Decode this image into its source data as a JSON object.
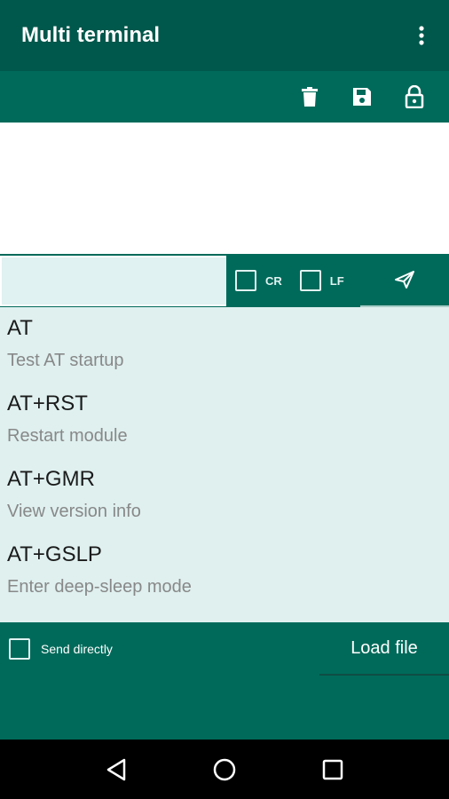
{
  "app": {
    "title": "Multi terminal"
  },
  "icons": {
    "overflow": "more-vert-icon",
    "clear": "trash-icon",
    "save": "save-icon",
    "lock": "lock-icon",
    "send": "send-icon",
    "nav_back": "back-triangle-icon",
    "nav_home": "home-circle-icon",
    "nav_recents": "recents-square-icon"
  },
  "colors": {
    "appbar": "#00574b",
    "toolbar": "#006a5a",
    "list_background": "#dff0ef",
    "input_background": "#e0f2f1"
  },
  "terminal": {
    "output": ""
  },
  "input_row": {
    "command_value": "",
    "cr_label": "CR",
    "cr_checked": false,
    "lf_label": "LF",
    "lf_checked": false
  },
  "commands": [
    {
      "name": "AT",
      "description": "Test AT startup"
    },
    {
      "name": "AT+RST",
      "description": "Restart module"
    },
    {
      "name": "AT+GMR",
      "description": "View version info"
    },
    {
      "name": "AT+GSLP",
      "description": "Enter deep-sleep mode"
    }
  ],
  "bottom": {
    "send_directly_label": "Send directly",
    "send_directly_checked": false,
    "load_file_label": "Load file"
  }
}
